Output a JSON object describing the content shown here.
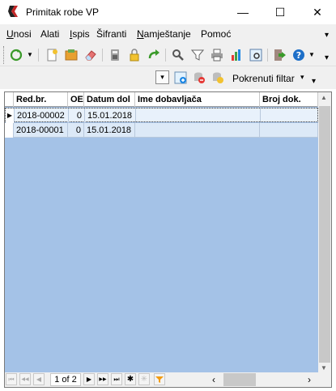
{
  "window": {
    "title": "Primitak robe VP",
    "minimize": "—",
    "maximize": "☐",
    "close": "✕"
  },
  "menu": {
    "items": [
      {
        "first": "U",
        "rest": "nosi"
      },
      {
        "first": "",
        "rest": "Alati"
      },
      {
        "first": "I",
        "rest": "spis"
      },
      {
        "first": "",
        "rest": "Šifranti"
      },
      {
        "first": "N",
        "rest": "amještanje"
      },
      {
        "first": "",
        "rest": "Pomoć"
      }
    ],
    "overflow": "▾"
  },
  "filter": {
    "label": "Pokrenuti filtar",
    "dropdown": "▾",
    "overflow": "▾"
  },
  "grid": {
    "columns": [
      "Red.br.",
      "OE",
      "Datum dol",
      "Ime dobavljača",
      "Broj dok."
    ],
    "rows": [
      [
        "2018-00002",
        "0",
        "15.01.2018",
        "",
        ""
      ],
      [
        "2018-00001",
        "0",
        "15.01.2018",
        "",
        ""
      ]
    ],
    "current_row_indicator": "▶"
  },
  "navigator": {
    "page_text": "1 of 2",
    "first": "⏮",
    "prev_page": "◀◀",
    "prev": "◀",
    "next": "▶",
    "next_page": "▶▶",
    "last": "⏭",
    "add": "✱",
    "scroll_left": "‹",
    "scroll_right": "›"
  },
  "colors": {
    "grid_background": "#a4c2e7",
    "row_odd": "#e8f1fb",
    "row_even": "#dce9f7"
  }
}
